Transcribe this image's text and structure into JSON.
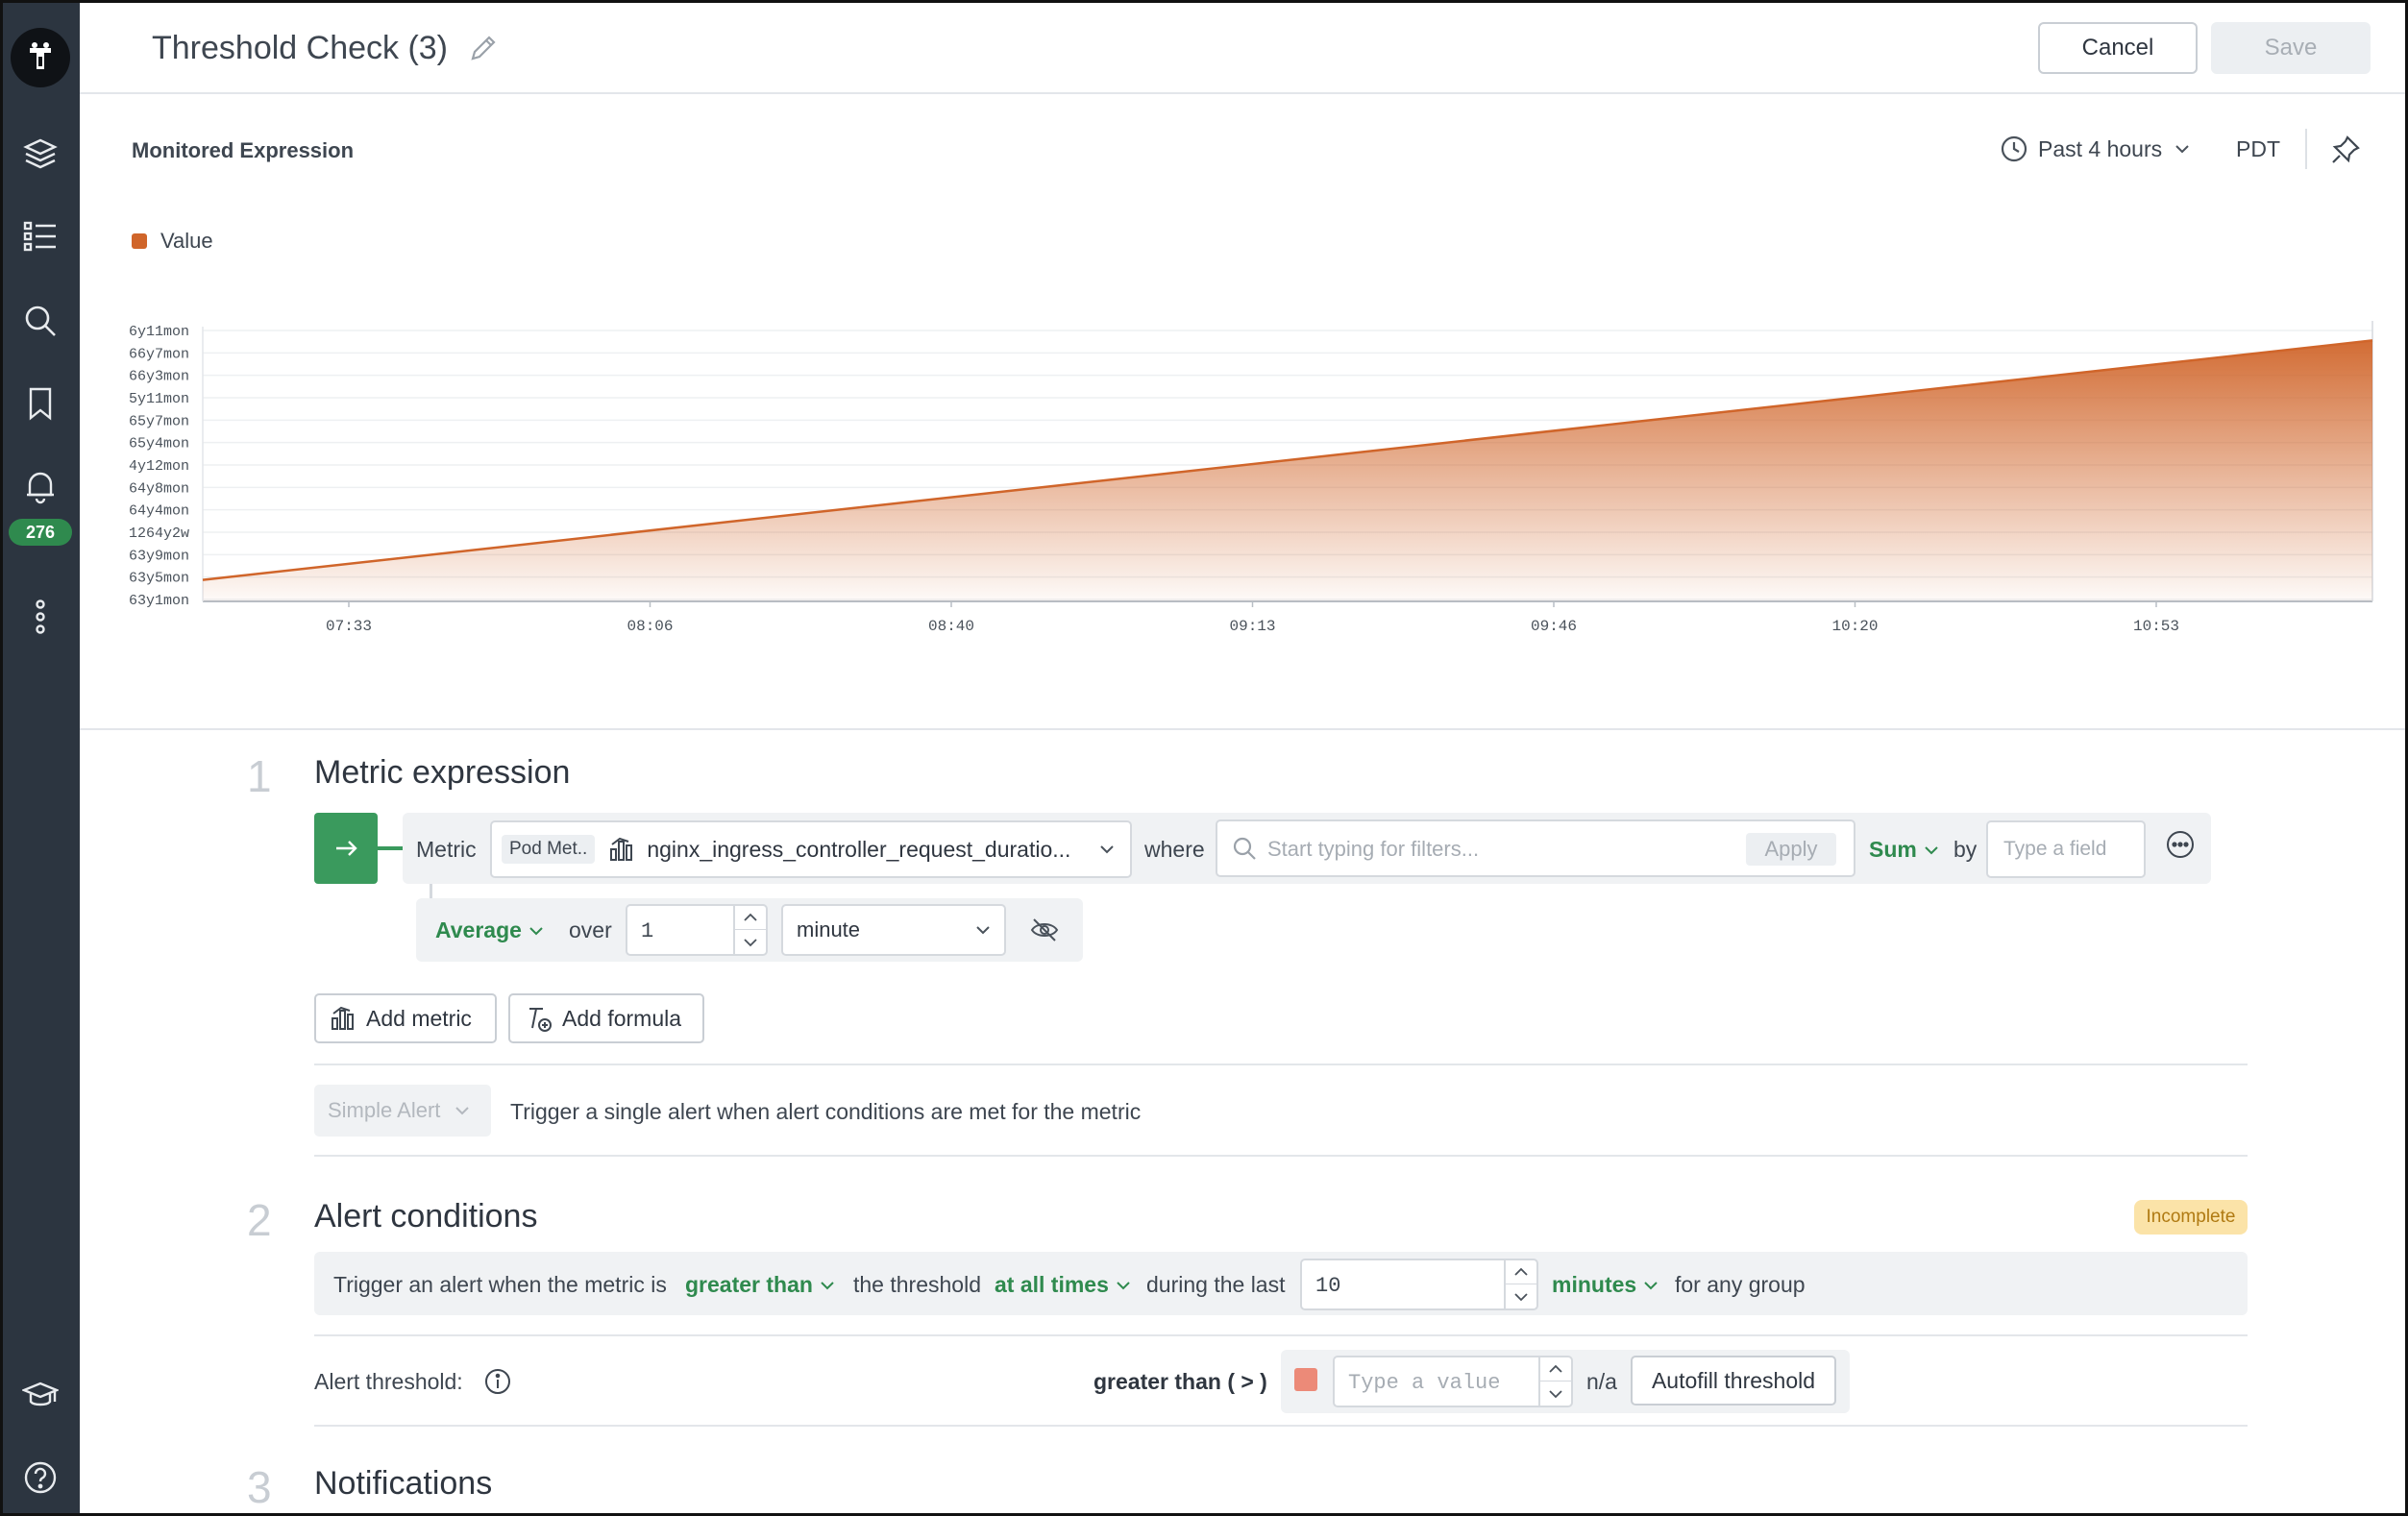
{
  "header": {
    "title": "Threshold Check (3)",
    "cancel_label": "Cancel",
    "save_label": "Save"
  },
  "sidebar": {
    "badge_count": "276",
    "icons": [
      "logo-icon",
      "layers-icon",
      "list-icon",
      "search-icon",
      "bookmark-icon",
      "bell-icon",
      "more-vertical-icon",
      "graduation-cap-icon",
      "help-icon"
    ]
  },
  "chart_panel": {
    "title": "Monitored Expression",
    "time_range": "Past 4 hours",
    "timezone": "PDT"
  },
  "chart_data": {
    "type": "area",
    "series": [
      {
        "name": "Value",
        "color": "#d0652a",
        "start": 0.08,
        "end": 0.97
      }
    ],
    "y_tick_labels": [
      "6y11mon",
      "66y7mon",
      "66y3mon",
      "5y11mon",
      "65y7mon",
      "65y4mon",
      "4y12mon",
      "64y8mon",
      "64y4mon",
      "1264y2w",
      "63y9mon",
      "63y5mon",
      "63y1mon"
    ],
    "x_tick_labels": [
      "07:33",
      "08:06",
      "08:40",
      "09:13",
      "09:46",
      "10:20",
      "10:53"
    ],
    "x_range": [
      "07:20",
      "11:10"
    ],
    "grid": true,
    "legend": "top-left"
  },
  "section1": {
    "number": "1",
    "title": "Metric expression",
    "metric_label": "Metric",
    "metric_source": "Pod Met..",
    "metric_name": "nginx_ingress_controller_request_duratio...",
    "where_label": "where",
    "filter_placeholder": "Start typing for filters...",
    "apply_label": "Apply",
    "aggregation": "Sum",
    "by_label": "by",
    "field_placeholder": "Type a field",
    "rollup": "Average",
    "over_label": "over",
    "over_value": "1",
    "unit": "minute",
    "add_metric_label": "Add metric",
    "add_formula_label": "Add formula",
    "alert_type": "Simple Alert",
    "alert_type_desc": "Trigger a single alert when alert conditions are met for the metric"
  },
  "section2": {
    "number": "2",
    "title": "Alert conditions",
    "status_badge": "Incomplete",
    "cond_prefix": "Trigger an alert when the metric is",
    "comparator": "greater than",
    "cond_mid": "the threshold",
    "frequency": "at all times",
    "cond_during": "during the last",
    "duration_value": "10",
    "duration_unit": "minutes",
    "cond_suffix": "for any group",
    "threshold_label": "Alert threshold:",
    "threshold_op": "greater than ( > )",
    "threshold_placeholder": "Type a value",
    "threshold_na": "n/a",
    "autofill_label": "Autofill threshold"
  },
  "section3": {
    "number": "3",
    "title": "Notifications"
  }
}
